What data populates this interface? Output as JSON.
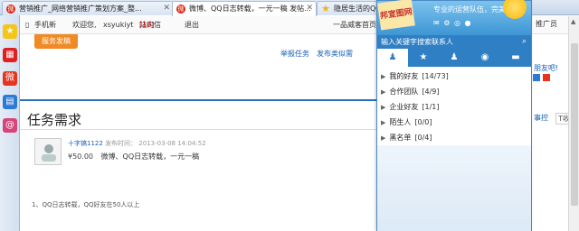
{
  "tabs": [
    {
      "label": "营销推广_网络营销推广策划方案_整...",
      "icon": "weibo-icon",
      "active": false
    },
    {
      "label": "微博、QQ日志转载，一元一稿 发帖...",
      "icon": "weibo-icon",
      "active": true
    },
    {
      "label": "隐居生活的QQ...",
      "icon": "star-icon",
      "active": false
    }
  ],
  "topbar": {
    "mobile": "手机新",
    "welcome": "欢迎您,",
    "username": "xsyukiyt",
    "inbox_label": "站内信",
    "inbox_count": "[18]",
    "logout": "退出",
    "right_text": "一品威客首页"
  },
  "post_button": "服务发稿",
  "links": {
    "report_task": "举报任务",
    "post_similar": "发布类似需"
  },
  "task": {
    "heading": "任务需求",
    "author": "十字镐1122",
    "published_label": "发布时间：",
    "published_time": "2013-03-08 14:04:52",
    "price": "¥50.00",
    "summary": "微博、QQ日志转载，一元一稿",
    "requirement_1": "1、QQ日志转载，QQ好友在50人以上"
  },
  "right_fragments": {
    "promo": "推广员",
    "friend_promo": "朋友吧!",
    "favorite": "事控",
    "fav2": "T收"
  },
  "qq": {
    "logo_text": "邦宣图网",
    "signature": "专业的运营队伍，完美...",
    "search_placeholder": "输入关键字搜索联系人",
    "groups": [
      {
        "name": "我的好友",
        "count": "[14/73]"
      },
      {
        "name": "合作团队",
        "count": "[4/9]"
      },
      {
        "name": "企业好友",
        "count": "[1/1]"
      },
      {
        "name": "陌生人",
        "count": "[0/0]"
      },
      {
        "name": "黑名单",
        "count": "[0/4]"
      }
    ]
  },
  "colors": {
    "accent": "#2f7fc4",
    "orange": "#f08a24",
    "brand_red": "#d9230f"
  }
}
